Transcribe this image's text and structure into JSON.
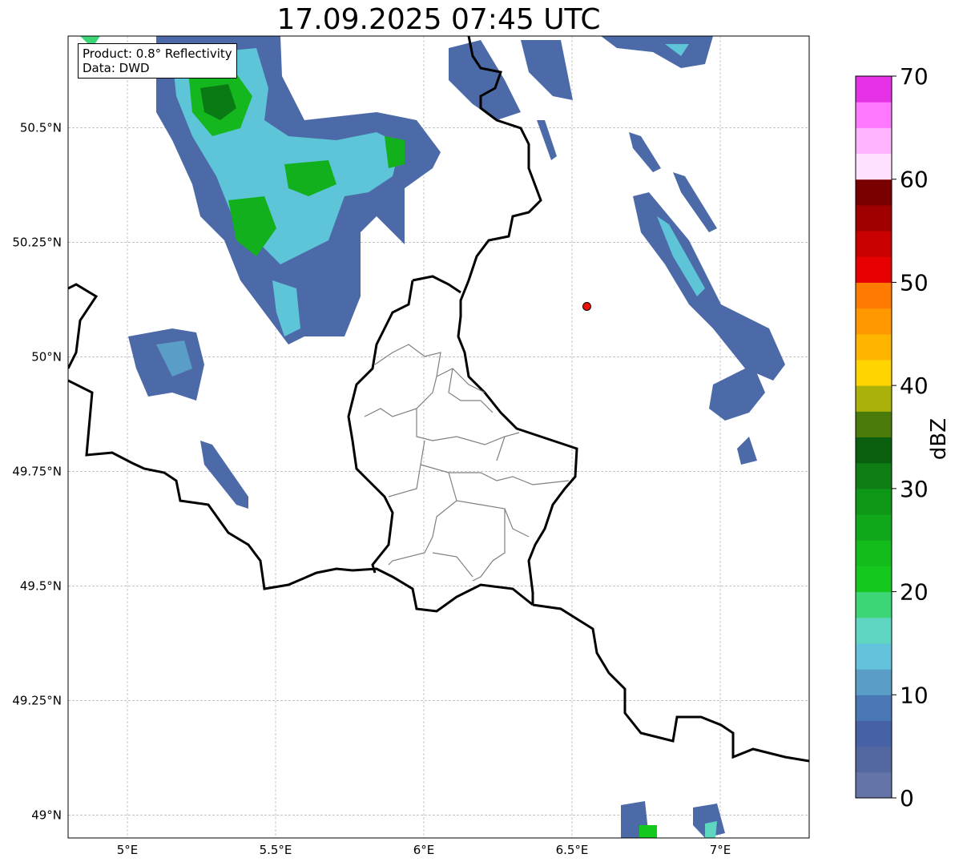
{
  "title": "17.09.2025 07:45 UTC",
  "info": {
    "product": "Product: 0.8° Reflectivity",
    "data": "Data: DWD"
  },
  "map": {
    "lon_range": [
      4.8,
      7.3
    ],
    "lat_range": [
      48.95,
      50.7
    ],
    "x_ticks": [
      {
        "value": 5.0,
        "label": "5°E"
      },
      {
        "value": 5.5,
        "label": "5.5°E"
      },
      {
        "value": 6.0,
        "label": "6°E"
      },
      {
        "value": 6.5,
        "label": "6.5°E"
      },
      {
        "value": 7.0,
        "label": "7°E"
      }
    ],
    "y_ticks": [
      {
        "value": 50.5,
        "label": "50.5°N"
      },
      {
        "value": 50.25,
        "label": "50.25°N"
      },
      {
        "value": 50.0,
        "label": "50°N"
      },
      {
        "value": 49.75,
        "label": "49.75°N"
      },
      {
        "value": 49.5,
        "label": "49.5°N"
      },
      {
        "value": 49.25,
        "label": "49.25°N"
      },
      {
        "value": 49.0,
        "label": "49°N"
      }
    ],
    "grid": true,
    "radar_site": {
      "lon": 6.55,
      "lat": 50.11,
      "color": "#e8140c"
    }
  },
  "colorbar": {
    "label": "dBZ",
    "min": 0,
    "max": 70,
    "step": 2.5,
    "tick_values": [
      0,
      10,
      20,
      30,
      40,
      50,
      60,
      70
    ],
    "tick_labels": [
      "0",
      "10",
      "20",
      "30",
      "40",
      "50",
      "60",
      "70"
    ],
    "colors": [
      "#6474a8",
      "#5468a0",
      "#4661a6",
      "#4a78b4",
      "#5a9ec8",
      "#64c3dc",
      "#5ed6c2",
      "#3dd676",
      "#14c81e",
      "#12bc1a",
      "#10a81a",
      "#0e9617",
      "#0e7d14",
      "#0a5f0e",
      "#4a7a0a",
      "#aab20a",
      "#ffd400",
      "#ffb400",
      "#ff9800",
      "#ff7a00",
      "#e60000",
      "#c80000",
      "#a00000",
      "#780000",
      "#ffe0ff",
      "#ffb4ff",
      "#ff78ff",
      "#e632e6"
    ]
  }
}
